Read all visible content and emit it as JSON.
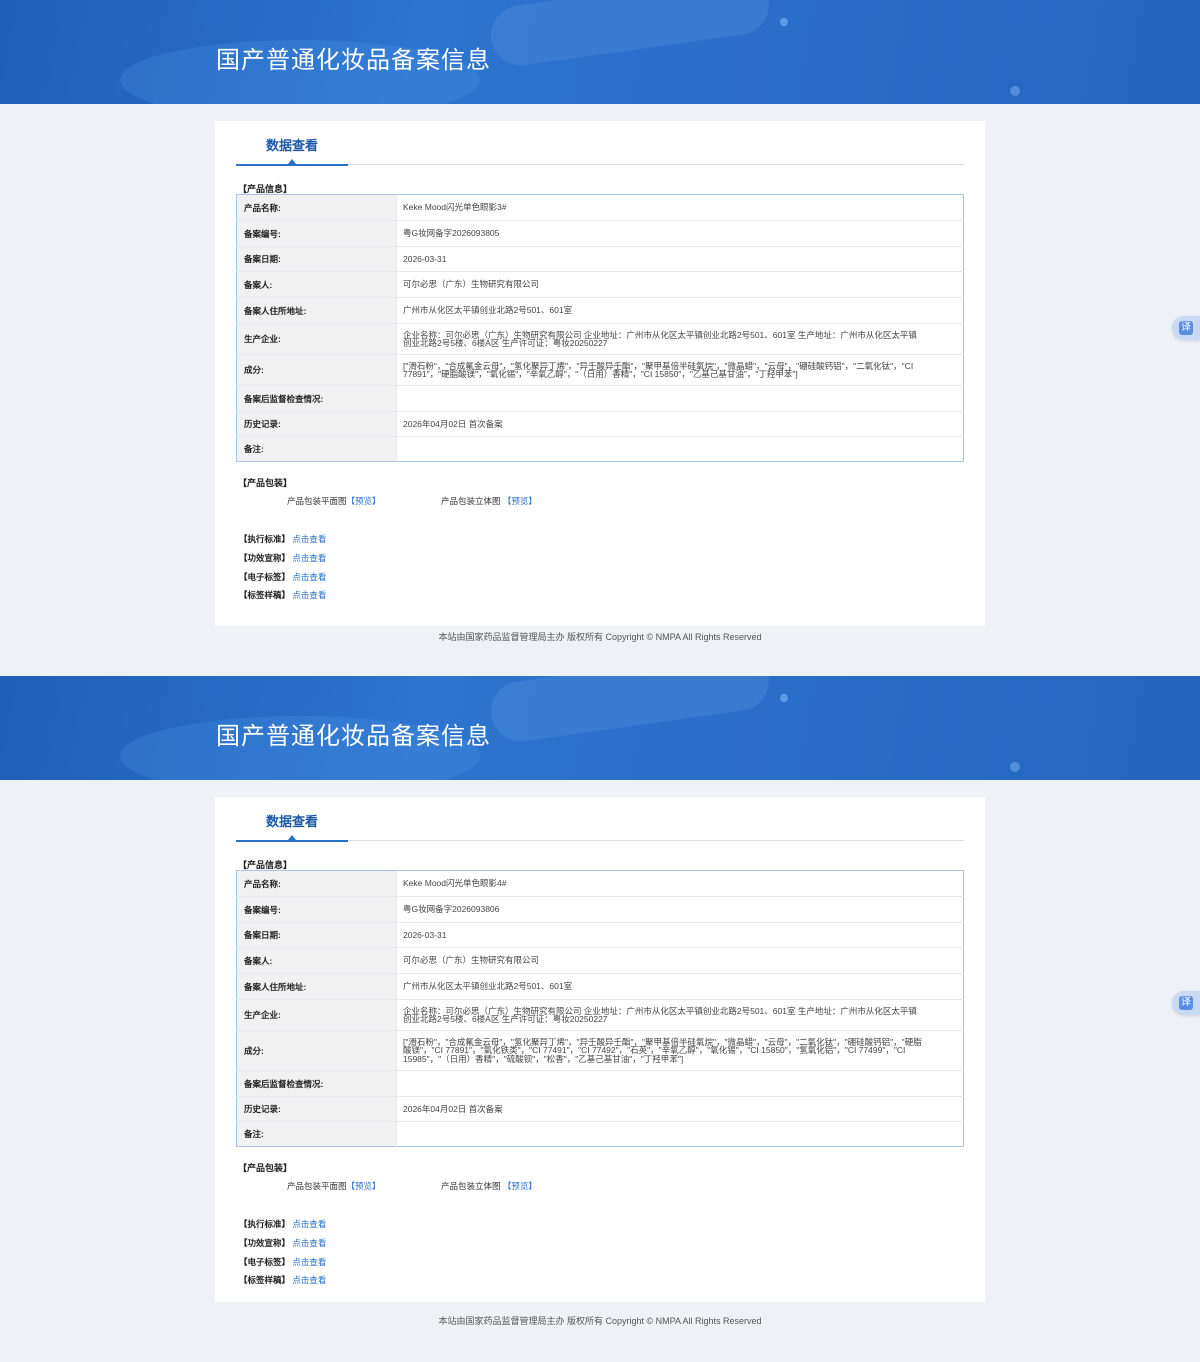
{
  "pages": [
    {
      "banner_title": "国产普通化妆品备案信息",
      "tab_label": "数据查看",
      "section_product_info": "【产品信息】",
      "rows": [
        {
          "label": "产品名称:",
          "value": "Keke Mood闪光单色眼影3#"
        },
        {
          "label": "备案编号:",
          "value": "粤G妆网备字2026093805"
        },
        {
          "label": "备案日期:",
          "value": "2026-03-31"
        },
        {
          "label": "备案人:",
          "value": "可尔必思（广东）生物研究有限公司"
        },
        {
          "label": "备案人住所地址:",
          "value": "广州市从化区太平镇创业北路2号501、601室"
        },
        {
          "label": "生产企业:",
          "value": "企业名称：可尔必思（广东）生物研究有限公司 企业地址：广州市从化区太平镇创业北路2号501、601室 生产地址：广州市从化区太平镇创业北路2号5楼、6楼A区 生产许可证：粤妆20250227"
        },
        {
          "label": "成分:",
          "value": "[\"滑石粉\"，\"合成氟金云母\"，\"氢化聚异丁烯\"，\"异壬酸异壬酯\"，\"聚甲基倍半硅氧烷\"，\"微晶蜡\"，\"云母\"，\"硼硅酸钙铝\"，\"二氧化钛\"，\"CI 77891\"，\"硬脂酸镁\"，\"氧化锡\"，\"辛氧乙醇\"，\"（日用）香精\"，\"CI 15850\"，\"乙基己基甘油\"，\"丁羟甲苯\"]"
        },
        {
          "label": "备案后监督检查情况:",
          "value": ""
        },
        {
          "label": "历史记录:",
          "value": "2026年04月02日 首次备案"
        },
        {
          "label": "备注:",
          "value": ""
        }
      ],
      "section_packaging": "【产品包装】",
      "pkg_flat_label": "产品包装平面图",
      "pkg_flat_link": "【预览】",
      "pkg_3d_label": "产品包装立体图",
      "pkg_3d_link": "【预览】",
      "links": [
        {
          "label": "【执行标准】",
          "link": "点击查看"
        },
        {
          "label": "【功效宣称】",
          "link": "点击查看"
        },
        {
          "label": "【电子标签】",
          "link": "点击查看"
        },
        {
          "label": "【标签样稿】",
          "link": "点击查看"
        }
      ],
      "footer": "本站由国家药品监督管理局主办 版权所有 Copyright © NMPA All Rights Reserved",
      "translate_label": "译"
    },
    {
      "banner_title": "国产普通化妆品备案信息",
      "tab_label": "数据查看",
      "section_product_info": "【产品信息】",
      "rows": [
        {
          "label": "产品名称:",
          "value": "Keke Mood闪光单色眼影4#"
        },
        {
          "label": "备案编号:",
          "value": "粤G妆网备字2026093806"
        },
        {
          "label": "备案日期:",
          "value": "2026-03-31"
        },
        {
          "label": "备案人:",
          "value": "可尔必思（广东）生物研究有限公司"
        },
        {
          "label": "备案人住所地址:",
          "value": "广州市从化区太平镇创业北路2号501、601室"
        },
        {
          "label": "生产企业:",
          "value": "企业名称：可尔必思（广东）生物研究有限公司 企业地址：广州市从化区太平镇创业北路2号501、601室 生产地址：广州市从化区太平镇创业北路2号5楼、6楼A区 生产许可证：粤妆20250227"
        },
        {
          "label": "成分:",
          "value": "[\"滑石粉\"，\"合成氟金云母\"，\"氢化聚异丁烯\"，\"异壬酸异壬酯\"，\"聚甲基倍半硅氧烷\"，\"微晶蜡\"，\"云母\"，\"二氧化钛\"，\"硼硅酸钙铝\"，\"硬脂酸镁\"，\"CI 77891\"，\"氧化铁类\"，\"CI 77491\"，\"CI 77492\"，\"石英\"，\"辛氧乙醇\"，\"氧化锡\"，\"CI 15850\"，\"氢氧化铝\"，\"CI 77499\"，\"CI 15985\"，\"（日用）香精\"，\"硫酸钡\"，\"松香\"，\"乙基己基甘油\"，\"丁羟甲苯\"]"
        },
        {
          "label": "备案后监督检查情况:",
          "value": ""
        },
        {
          "label": "历史记录:",
          "value": "2026年04月02日 首次备案"
        },
        {
          "label": "备注:",
          "value": ""
        }
      ],
      "section_packaging": "【产品包装】",
      "pkg_flat_label": "产品包装平面图",
      "pkg_flat_link": "【预览】",
      "pkg_3d_label": "产品包装立体图",
      "pkg_3d_link": "【预览】",
      "links": [
        {
          "label": "【执行标准】",
          "link": "点击查看"
        },
        {
          "label": "【功效宣称】",
          "link": "点击查看"
        },
        {
          "label": "【电子标签】",
          "link": "点击查看"
        },
        {
          "label": "【标签样稿】",
          "link": "点击查看"
        }
      ],
      "footer": "本站由国家药品监督管理局主办 版权所有 Copyright © NMPA All Rights Reserved",
      "translate_label": "译"
    }
  ]
}
